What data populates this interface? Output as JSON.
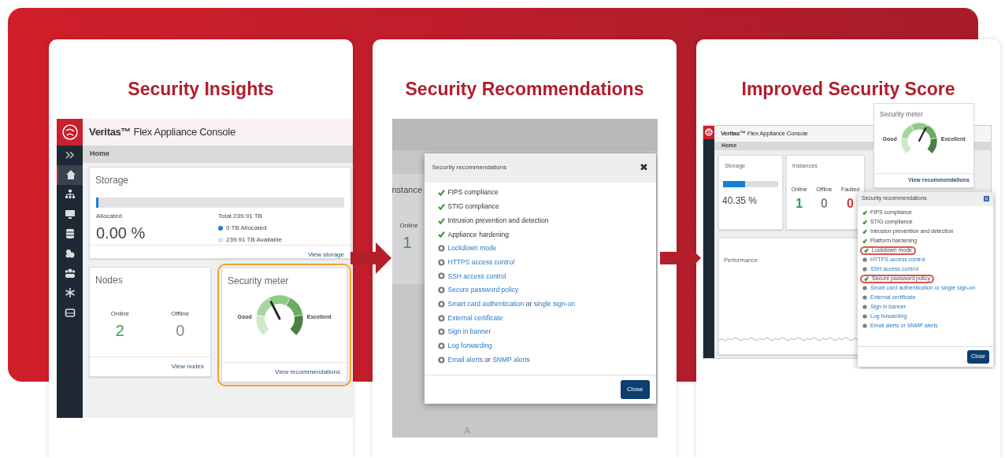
{
  "panels": [
    {
      "kind": "insights",
      "title": "Security Insights",
      "app_title": "**Veritas™** Flex Appliance Console",
      "breadcrumb": "Home",
      "nav": [
        {
          "selected": false
        },
        {
          "selected": true
        },
        {
          "selected": false
        },
        {
          "selected": false
        },
        {
          "selected": false
        },
        {
          "selected": false
        },
        {
          "selected": false
        },
        {
          "selected": false
        },
        {
          "selected": false
        }
      ],
      "storage": {
        "title": "Storage",
        "level": 0.01,
        "label": "Allocated",
        "percent": "0.00 %",
        "total": "Total 239.91 TB",
        "legend": [
          {
            "text": "0 TB Allocated",
            "color": "#1a7fd4"
          },
          {
            "text": "239.91 TB Available",
            "color": "#dddddd"
          }
        ],
        "link": "View storage"
      },
      "nodes": {
        "title": "Nodes",
        "stats": [
          {
            "label": "Online",
            "value": "2",
            "color": "#3c9a4c"
          },
          {
            "label": "Offline",
            "value": "0",
            "color": "#8a8a8a"
          }
        ],
        "link": "View nodes"
      },
      "meter": {
        "title": "Security meter",
        "level": 0.4,
        "low": "Good",
        "high": "Excellent",
        "link": "View recommendations",
        "highlighted": true
      }
    },
    {
      "kind": "recommendations",
      "title": "Security Recommendations",
      "behind": {
        "heading": "nstance",
        "stat_label": "Online",
        "stat_value": "1",
        "fragment": "A"
      },
      "dialog": {
        "title": "Security recommendations",
        "close_icon": "✖",
        "button": "Close",
        "items": [
          {
            "done": true,
            "parts": [
              {
                "text": "FIPS compliance",
                "link": false
              }
            ]
          },
          {
            "done": true,
            "parts": [
              {
                "text": "STIG compliance",
                "link": false
              }
            ]
          },
          {
            "done": true,
            "parts": [
              {
                "text": "Intrusion prevention and detection",
                "link": false
              }
            ]
          },
          {
            "done": true,
            "parts": [
              {
                "text": "Appliance hardening",
                "link": false
              }
            ]
          },
          {
            "done": false,
            "parts": [
              {
                "text": "Lockdown mode",
                "link": true
              }
            ]
          },
          {
            "done": false,
            "parts": [
              {
                "text": "HTTPS access control",
                "link": true
              }
            ]
          },
          {
            "done": false,
            "parts": [
              {
                "text": "SSH access control",
                "link": true
              }
            ]
          },
          {
            "done": false,
            "parts": [
              {
                "text": "Secure password policy",
                "link": true
              }
            ]
          },
          {
            "done": false,
            "parts": [
              {
                "text": "Smart card authentication",
                "link": true
              },
              {
                "text": " or ",
                "link": false
              },
              {
                "text": "single sign-on",
                "link": true
              }
            ]
          },
          {
            "done": false,
            "parts": [
              {
                "text": "External certificate",
                "link": true
              }
            ]
          },
          {
            "done": false,
            "parts": [
              {
                "text": "Sign in banner",
                "link": true
              }
            ]
          },
          {
            "done": false,
            "parts": [
              {
                "text": "Log forwarding",
                "link": true
              }
            ]
          },
          {
            "done": false,
            "parts": [
              {
                "text": "Email alerts",
                "link": true
              },
              {
                "text": " or ",
                "link": false
              },
              {
                "text": "SNMP alerts",
                "link": true
              }
            ]
          }
        ]
      }
    },
    {
      "kind": "improved",
      "title": "Improved Security Score",
      "app_title": "**Veritas™** Flex Appliance Console",
      "breadcrumb": "Home",
      "storage": {
        "title": "Storage",
        "level": 0.4,
        "percent": "40.35 %"
      },
      "instances": {
        "title": "Instances",
        "stats": [
          {
            "label": "Online",
            "value": "1",
            "color": "#3c9a4c"
          },
          {
            "label": "Offline",
            "value": "0",
            "color": "#8a8a8a"
          },
          {
            "label": "Faulted",
            "value": "0",
            "color": "#d43a3a"
          }
        ]
      },
      "performance": {
        "title": "Performance"
      },
      "meter": {
        "title": "Security meter",
        "level": 0.6,
        "low": "Good",
        "high": "Excellent",
        "link": "View recommendations"
      },
      "dialog": {
        "title": "Security recommendations",
        "button": "Close",
        "items": [
          {
            "done": true,
            "highlighted": false,
            "text": "FIPS compliance"
          },
          {
            "done": true,
            "highlighted": false,
            "text": "STIG compliance"
          },
          {
            "done": true,
            "highlighted": false,
            "text": "Intrusion prevention and detection"
          },
          {
            "done": true,
            "highlighted": false,
            "text": "Platform hardening"
          },
          {
            "done": true,
            "highlighted": true,
            "text": "Lockdown mode"
          },
          {
            "done": false,
            "highlighted": false,
            "text": "HTTPS access control"
          },
          {
            "done": false,
            "highlighted": false,
            "text": "SSH access control"
          },
          {
            "done": true,
            "highlighted": true,
            "text": "Secure password policy"
          },
          {
            "done": false,
            "highlighted": false,
            "text": "Smart card authentication or single sign-on"
          },
          {
            "done": false,
            "highlighted": false,
            "text": "External certificate"
          },
          {
            "done": false,
            "highlighted": false,
            "text": "Sign in banner"
          },
          {
            "done": false,
            "highlighted": false,
            "text": "Log forwarding"
          },
          {
            "done": false,
            "highlighted": false,
            "text": "Email alerts or SNMP alerts"
          }
        ]
      }
    }
  ]
}
